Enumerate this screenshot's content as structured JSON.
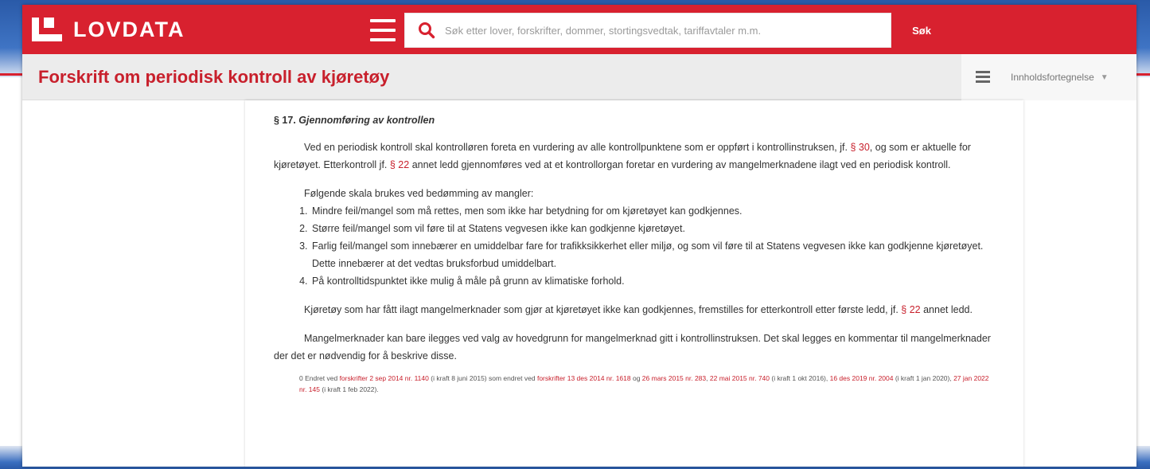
{
  "header": {
    "logo_text": "LOVDATA",
    "search_placeholder": "Søk etter lover, forskrifter, dommer, stortingsvedtak, tariffavtaler m.m.",
    "search_button": "Søk",
    "brand_color": "#d8212f"
  },
  "titlebar": {
    "title": "Forskrift om periodisk kontroll av kjøretøy",
    "toc_label": "Innholdsfortegnelse"
  },
  "document": {
    "section_number": "§ 17.",
    "section_title": "Gjennomføring av kontrollen",
    "p1": {
      "a": "Ved en periodisk kontroll skal kontrolløren foreta en vurdering av alle kontrollpunktene som er oppført i kontrollinstruksen, jf. ",
      "link1": "§ 30",
      "b": ", og som er aktuelle for kjøretøyet. Etterkontroll jf. ",
      "link2": "§ 22",
      "c": " annet ledd gjennomføres ved at et kontrollorgan foretar en vurdering av mangelmerknadene ilagt ved en periodisk kontroll."
    },
    "list_intro": "Følgende skala brukes ved bedømming av mangler:",
    "list_items": [
      "Mindre feil/mangel som må rettes, men som ikke har betydning for om kjøretøyet kan godkjennes.",
      "Større feil/mangel som vil føre til at Statens vegvesen ikke kan godkjenne kjøretøyet.",
      "Farlig feil/mangel som innebærer en umiddelbar fare for trafikksikkerhet eller miljø, og som vil føre til at Statens vegvesen ikke kan godkjenne kjøretøyet. Dette innebærer at det vedtas bruksforbud umiddelbart.",
      "På kontrolltidspunktet ikke mulig å måle på grunn av klimatiske forhold."
    ],
    "p2": {
      "a": "Kjøretøy som har fått ilagt mangelmerknader som gjør at kjøretøyet ikke kan godkjennes, fremstilles for etterkontroll etter første ledd, jf. ",
      "link": "§ 22",
      "b": " annet ledd."
    },
    "p3": "Mangelmerknader kan bare ilegges ved valg av hovedgrunn for mangelmerknad gitt i kontrollinstruksen. Det skal legges en kommentar til mangelmerknader der det er nødvendig for å beskrive disse.",
    "note": {
      "prefix": "0   Endret ved ",
      "link1": "forskrifter 2 sep 2014 nr. 1140",
      "b": " (i kraft 8 juni 2015) som endret ved ",
      "link2": "forskrifter 13 des 2014 nr. 1618",
      "c": " og ",
      "link3": "26 mars 2015 nr. 283",
      "d": ", ",
      "link4": "22 mai 2015 nr. 740",
      "e": " (i kraft 1 okt 2016), ",
      "link5": "16 des 2019 nr. 2004",
      "f": " (i kraft 1 jan 2020), ",
      "link6": "27 jan 2022 nr. 145",
      "g": " (i kraft 1 feb 2022)."
    }
  }
}
